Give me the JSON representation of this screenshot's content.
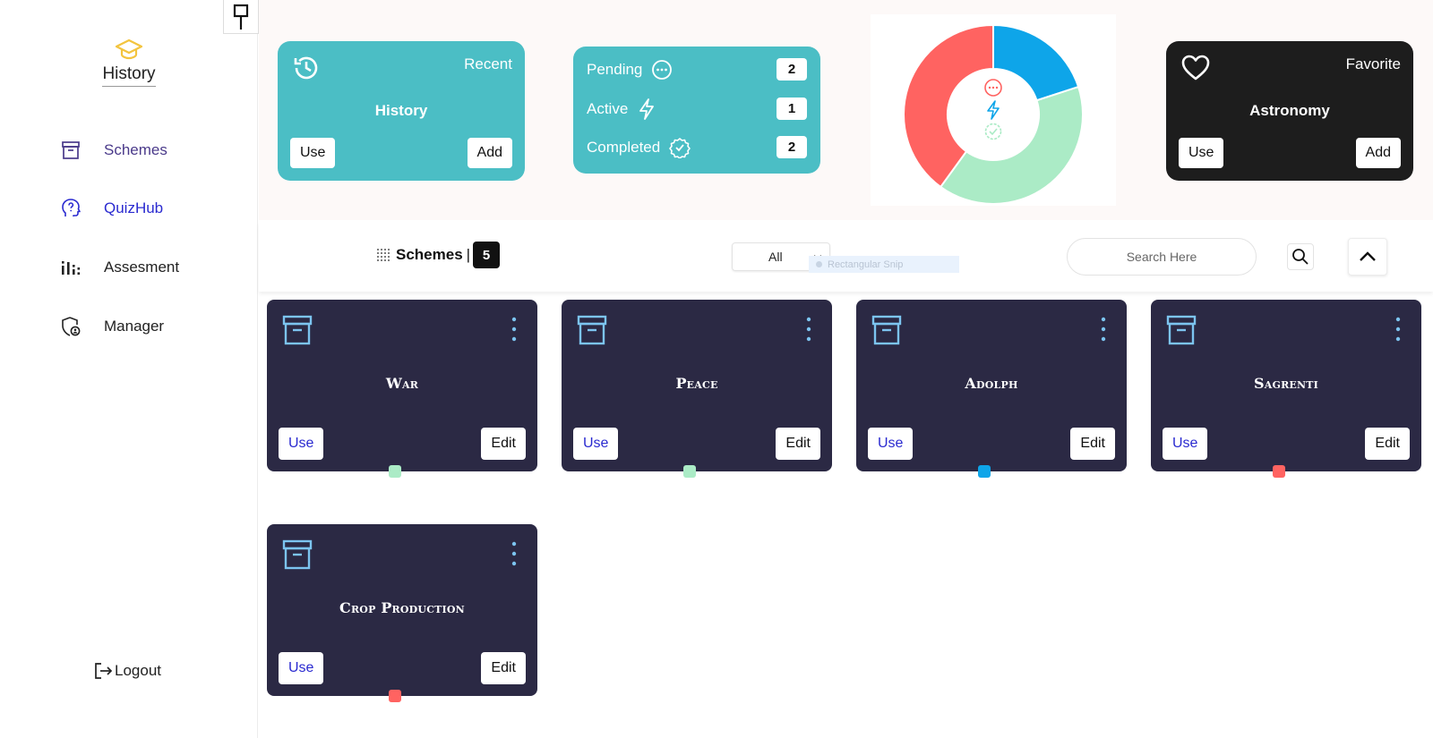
{
  "sidebar": {
    "brand": {
      "name": "History",
      "icon": "graduation-cap-icon",
      "icon_color": "#f3c43e"
    },
    "items": [
      {
        "label": "Schemes",
        "icon": "archive-box-icon",
        "color": "#4a3a8a"
      },
      {
        "label": "QuizHub",
        "icon": "head-question-icon",
        "color": "#2a2ad0"
      },
      {
        "label": "Assesment",
        "icon": "bar-chart-icon",
        "color": "#222222"
      },
      {
        "label": "Manager",
        "icon": "shield-user-icon",
        "color": "#222222"
      }
    ],
    "logout_label": "Logout"
  },
  "stats": {
    "recent_card": {
      "corner_label": "Recent",
      "title": "History",
      "use_label": "Use",
      "add_label": "Add",
      "icon": "history-clock-icon"
    },
    "status_card": {
      "rows": [
        {
          "label": "Pending",
          "count": "2",
          "icon": "ellipsis-circle-icon"
        },
        {
          "label": "Active",
          "count": "1",
          "icon": "lightning-icon"
        },
        {
          "label": "Completed",
          "count": "2",
          "icon": "badge-check-icon"
        }
      ]
    },
    "favorite_card": {
      "corner_label": "Favorite",
      "title": "Astronomy",
      "use_label": "Use",
      "add_label": "Add",
      "icon": "heart-icon"
    }
  },
  "chart_data": {
    "type": "pie",
    "donut": true,
    "title": "",
    "slices": [
      {
        "name": "Active",
        "value": 1,
        "color": "#0ea5e9"
      },
      {
        "name": "Completed",
        "value": 2,
        "color": "#abebc6"
      },
      {
        "name": "Pending",
        "value": 2,
        "color": "#ff6361"
      }
    ]
  },
  "toolbar": {
    "title": "Schemes",
    "separator": "|",
    "count": "5",
    "filter_selected": "All",
    "snip_hint": "Rectangular Snip",
    "search_placeholder": "Search Here"
  },
  "schemes": [
    {
      "title": "War",
      "use_label": "Use",
      "edit_label": "Edit",
      "status_color": "#abebc6"
    },
    {
      "title": "Peace",
      "use_label": "Use",
      "edit_label": "Edit",
      "status_color": "#abebc6"
    },
    {
      "title": "Adolph",
      "use_label": "Use",
      "edit_label": "Edit",
      "status_color": "#0ea5e9"
    },
    {
      "title": "Sagrenti",
      "use_label": "Use",
      "edit_label": "Edit",
      "status_color": "#ff6361"
    },
    {
      "title": "Crop Production",
      "use_label": "Use",
      "edit_label": "Edit",
      "status_color": "#ff6361"
    }
  ],
  "colors": {
    "teal_card": "#4bbec5",
    "dark_card": "#1d1d1d",
    "scheme_card": "#2b2944",
    "scheme_icon": "#7cc4f0"
  }
}
